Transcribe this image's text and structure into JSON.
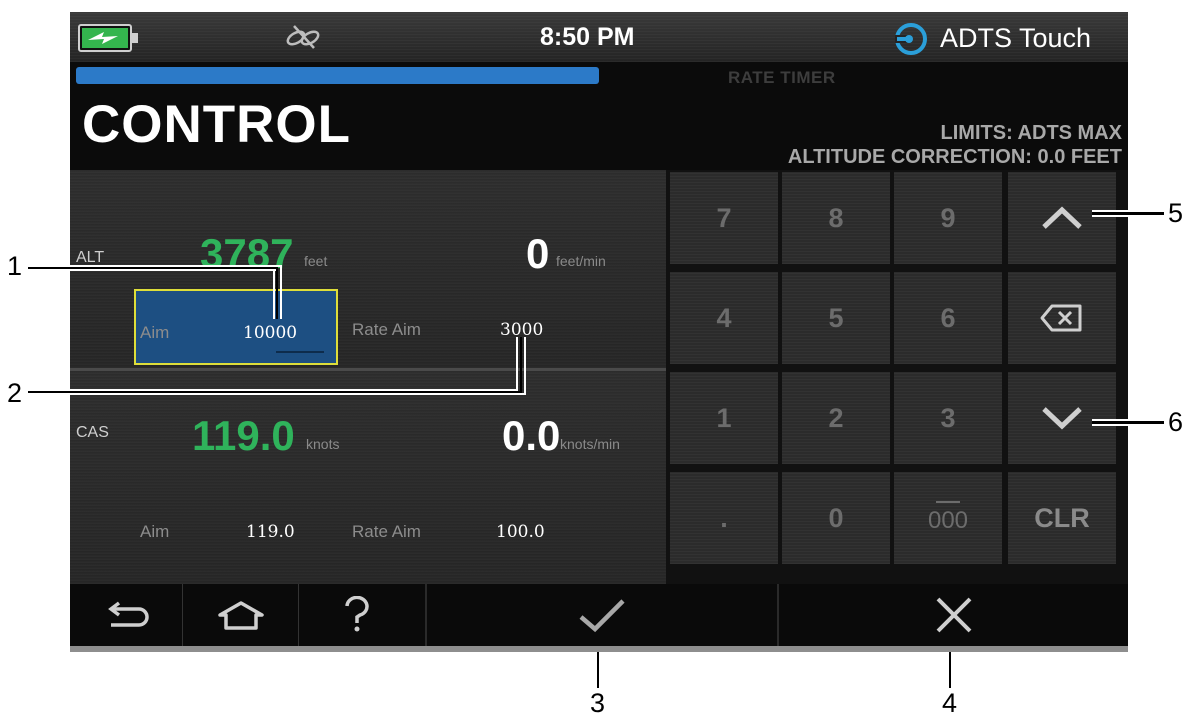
{
  "status": {
    "time": "8:50 PM",
    "brand": "ADTS Touch",
    "icons": [
      "battery-charging-icon",
      "link-off-icon",
      "druck-logo-icon"
    ]
  },
  "header": {
    "rate_timer": "RATE TIMER",
    "title": "CONTROL",
    "limits": "LIMITS: ADTS MAX",
    "altitude_correction": "ALTITUDE CORRECTION: 0.0 FEET",
    "progress_fraction": 0.5
  },
  "alt": {
    "label": "ALT",
    "value": "3787",
    "unit": "feet",
    "rate": "0",
    "rate_unit": "feet/min",
    "aim_label": "Aim",
    "aim_value": "10000",
    "rate_aim_label": "Rate Aim",
    "rate_aim_value": "3000"
  },
  "cas": {
    "label": "CAS",
    "value": "119.0",
    "unit": "knots",
    "rate": "0.0",
    "rate_unit": "knots/min",
    "aim_label": "Aim",
    "aim_value": "119.0",
    "rate_aim_label": "Rate Aim",
    "rate_aim_value": "100.0"
  },
  "keypad": {
    "keys": [
      "7",
      "8",
      "9",
      "4",
      "5",
      "6",
      "1",
      "2",
      "3",
      ".",
      "0",
      "000",
      "CLR"
    ],
    "side_icons": [
      "chevron-up-icon",
      "backspace-icon",
      "chevron-down-icon"
    ]
  },
  "bottom": {
    "icons": [
      "back-icon",
      "home-icon",
      "help-icon",
      "confirm-check-icon",
      "cancel-x-icon"
    ]
  },
  "callouts": [
    "1",
    "2",
    "3",
    "4",
    "5",
    "6"
  ]
}
